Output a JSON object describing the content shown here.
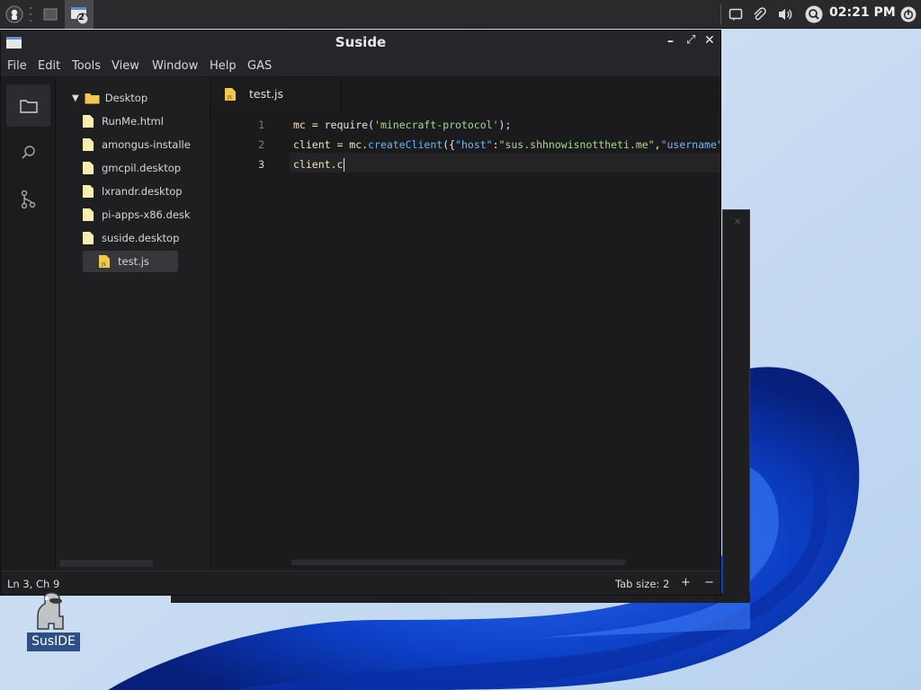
{
  "taskbar": {
    "time": "02:21 PM",
    "task_badge": "2",
    "icons": [
      "app-menu-icon",
      "show-desktop-icon",
      "window-task-icon",
      "notification-icon",
      "paperclip-icon",
      "volume-icon",
      "search-icon",
      "power-icon"
    ]
  },
  "window": {
    "title": "Suside",
    "menu": [
      "File",
      "Edit",
      "Tools",
      "View",
      "Window",
      "Help",
      "GAS"
    ]
  },
  "activity_bar": [
    "folder-icon",
    "search-icon",
    "git-branch-icon"
  ],
  "explorer": {
    "root": "Desktop",
    "files": [
      "RunMe.html",
      "amongus-installe",
      "gmcpil.desktop",
      "lxrandr.desktop",
      "pi-apps-x86.desk",
      "suside.desktop",
      "test.js"
    ],
    "selected": "test.js"
  },
  "editor": {
    "tab_label": "test.js",
    "tab_badge": "JS",
    "line_numbers": [
      "1",
      "2",
      "3"
    ],
    "lines": [
      [
        {
          "t": "mc = ",
          "c": "var"
        },
        {
          "t": "require",
          "c": "plain"
        },
        {
          "t": "(",
          "c": "plain"
        },
        {
          "t": "'minecraft-protocol'",
          "c": "str"
        },
        {
          "t": ");",
          "c": "plain"
        }
      ],
      [
        {
          "t": "client = mc.",
          "c": "var"
        },
        {
          "t": "createClient",
          "c": "fn"
        },
        {
          "t": "({",
          "c": "plain"
        },
        {
          "t": "\"host\"",
          "c": "key"
        },
        {
          "t": ":",
          "c": "plain"
        },
        {
          "t": "\"sus.shhnowisnottheti.me\"",
          "c": "str"
        },
        {
          "t": ",",
          "c": "plain"
        },
        {
          "t": "\"username\"",
          "c": "key"
        }
      ],
      [
        {
          "t": "client.c",
          "c": "var"
        }
      ]
    ]
  },
  "statusbar": {
    "position": "Ln 3, Ch 9",
    "tab_size": "Tab size: 2",
    "plus": "+",
    "minus": "−"
  },
  "desktop": {
    "icon_label": "SusIDE"
  },
  "colors": {
    "accent_js": "#f2c94c",
    "code_var": "#f5e6b0",
    "code_str": "#a8d98a",
    "code_key": "#7ab5f0",
    "code_fn": "#6db4f2"
  }
}
